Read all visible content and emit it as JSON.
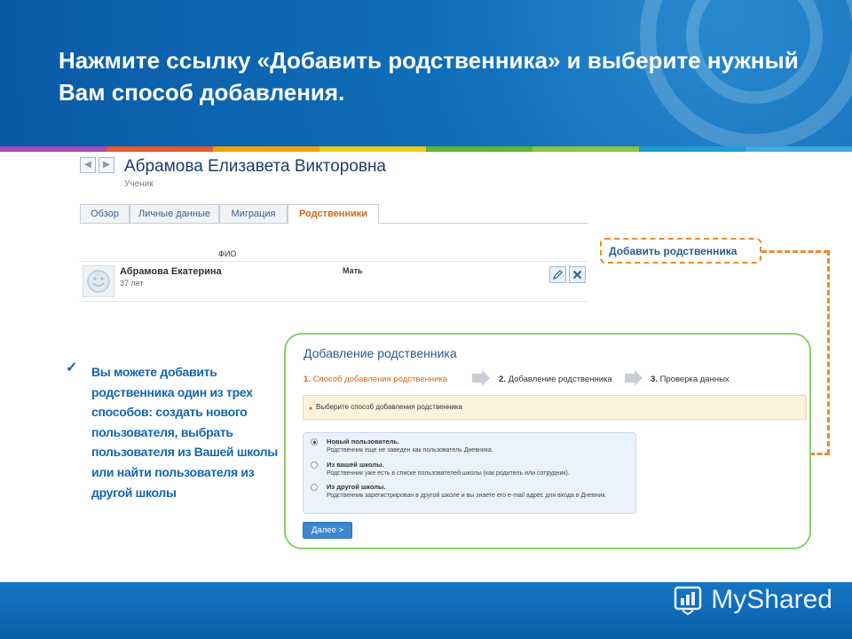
{
  "slide": {
    "title": "Нажмите ссылку «Добавить родственника» и выберите нужный Вам способ добавления.",
    "bullet": "Вы можете добавить родственника один из трех способов: создать нового пользователя, выбрать пользователя из Вашей школы или найти пользователя из другой школы",
    "brand": "MyShared",
    "stripe_colors": [
      "#a54cb0",
      "#ea5a2c",
      "#f1a200",
      "#eccc1a",
      "#62b531",
      "#8fc348",
      "#1e9ad6",
      "#43a9e0"
    ]
  },
  "profile": {
    "name": "Абрамова Елизавета Викторовна",
    "role": "Ученик",
    "tabs": [
      {
        "label": "Обзор"
      },
      {
        "label": "Личные данные"
      },
      {
        "label": "Миграция"
      },
      {
        "label": "Родственники",
        "active": true
      }
    ],
    "column_header": "ФИО",
    "relative": {
      "name": "Абрамова Екатерина",
      "age": "37 лет",
      "relation": "Мать"
    },
    "add_link": "Добавить родственника"
  },
  "dialog": {
    "title": "Добавление родственника",
    "steps": [
      {
        "number": "1.",
        "label": "Способ добавления родственника",
        "active": true
      },
      {
        "number": "2.",
        "label": "Добавление родственника"
      },
      {
        "number": "3.",
        "label": "Проверка данных"
      }
    ],
    "notice": "Выберите способ добавления родственника",
    "options": [
      {
        "title": "Новый пользователь.",
        "desc": "Родственник еще не заведен как пользователь Дневника.",
        "selected": true
      },
      {
        "title": "Из вашей школы.",
        "desc": "Родственник уже есть в списке пользователей школы (как родитель или сотрудник)."
      },
      {
        "title": "Из другой школы.",
        "desc": "Родственник зарегистрирован в другой школе и вы знаете его e-mail адрес для входа в Дневник."
      }
    ],
    "next_button": "Далее >"
  },
  "colors": {
    "accent_orange": "#ec8a2d",
    "dialog_border": "#8ad06a",
    "header_blue": "#0f6db8",
    "link_blue": "#2b5a8c"
  }
}
